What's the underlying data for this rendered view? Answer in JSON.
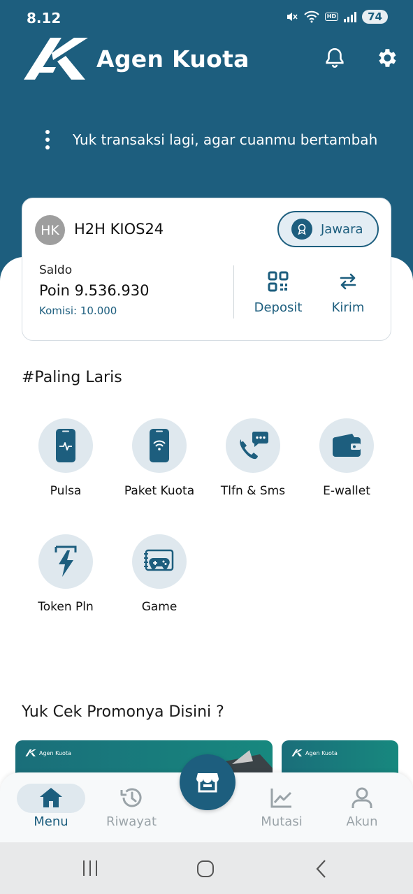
{
  "status_bar": {
    "time": "8.12",
    "battery": "74",
    "hd_badge": "HD\nVoice"
  },
  "brand": {
    "name": "Agen Kuota"
  },
  "header": {
    "tagline": "Yuk transaksi lagi, agar cuanmu bertambah"
  },
  "account": {
    "initials": "HK",
    "store_name": "H2H KIOS24",
    "tier": "Jawara",
    "saldo_label": "Saldo",
    "saldo_value": "Poin 9.536.930",
    "komisi": "Komisi: 10.000",
    "actions": [
      {
        "label": "Deposit",
        "icon": "qr-code-icon"
      },
      {
        "label": "Kirim",
        "icon": "transfer-arrows-icon"
      }
    ]
  },
  "best_seller": {
    "title": "#Paling Laris",
    "items": [
      {
        "label": "Pulsa",
        "icon": "phone-pulse-icon"
      },
      {
        "label": "Paket Kuota",
        "icon": "phone-wifi-icon"
      },
      {
        "label": "Tlfn & Sms",
        "icon": "phone-chat-icon"
      },
      {
        "label": "E-wallet",
        "icon": "wallet-icon"
      },
      {
        "label": "Token Pln",
        "icon": "lightning-icon"
      },
      {
        "label": "Game",
        "icon": "gamepad-icon"
      }
    ]
  },
  "promo": {
    "title": "Yuk Cek Promonya Disini ?",
    "card_brand": "Agen Kuota"
  },
  "bottom_nav": {
    "items": [
      {
        "label": "Menu",
        "icon": "home-icon",
        "active": true
      },
      {
        "label": "Riwayat",
        "icon": "history-icon",
        "active": false
      },
      {
        "label": "Mutasi",
        "icon": "chart-line-icon",
        "active": false
      },
      {
        "label": "Akun",
        "icon": "user-icon",
        "active": false
      }
    ],
    "center_icon": "store-icon"
  },
  "colors": {
    "primary": "#1d5e7e",
    "light_accent": "#dfe8ee",
    "inactive": "#9aa3a8"
  }
}
